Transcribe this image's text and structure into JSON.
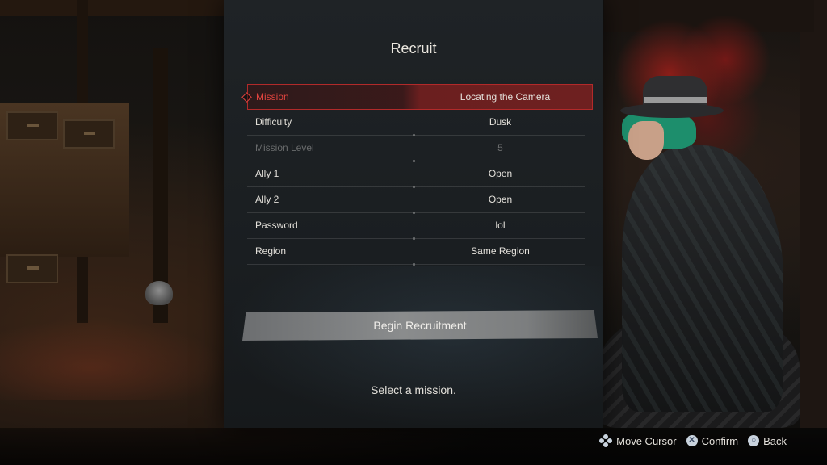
{
  "title": "Recruit",
  "rows": [
    {
      "label": "Mission",
      "value": "Locating the Camera",
      "state": "selected"
    },
    {
      "label": "Difficulty",
      "value": "Dusk",
      "state": "normal"
    },
    {
      "label": "Mission Level",
      "value": "5",
      "state": "disabled"
    },
    {
      "label": "Ally 1",
      "value": "Open",
      "state": "normal"
    },
    {
      "label": "Ally 2",
      "value": "Open",
      "state": "normal"
    },
    {
      "label": "Password",
      "value": "lol",
      "state": "normal"
    },
    {
      "label": "Region",
      "value": "Same Region",
      "state": "normal"
    }
  ],
  "begin_button": "Begin Recruitment",
  "hint": "Select a mission.",
  "controls": {
    "move_cursor": "Move Cursor",
    "confirm": "Confirm",
    "back": "Back",
    "move_cursor_icon": "dpad-icon",
    "confirm_icon": "cross-button-icon",
    "back_icon": "circle-button-icon",
    "confirm_glyph": "✕",
    "back_glyph": "○"
  },
  "colors": {
    "accent_red": "#b22a2a",
    "selected_label": "#e0443f"
  }
}
